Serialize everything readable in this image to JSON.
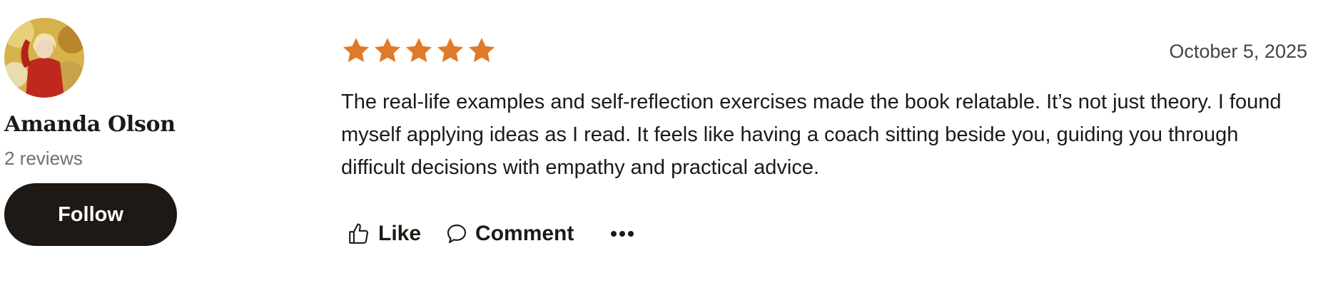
{
  "reviewer": {
    "name": "Amanda Olson",
    "review_count": "2 reviews",
    "follow_label": "Follow",
    "avatar_icon": "avatar-photo"
  },
  "review": {
    "rating": 5,
    "rating_max": 5,
    "date": "October 5, 2025",
    "text": "The real-life examples and self-reflection exercises made the book relatable. It’s not just theory. I found myself applying ideas as I read. It feels like having a coach sitting beside you, guiding you through difficult decisions with empathy and practical advice."
  },
  "actions": {
    "like_label": "Like",
    "comment_label": "Comment",
    "like_icon": "thumbs-up-icon",
    "comment_icon": "speech-bubble-icon",
    "more_icon": "more-options-icon"
  },
  "colors": {
    "star": "#e07a28",
    "button_bg": "#1e1915",
    "text": "#1e1915",
    "muted": "#707070"
  }
}
